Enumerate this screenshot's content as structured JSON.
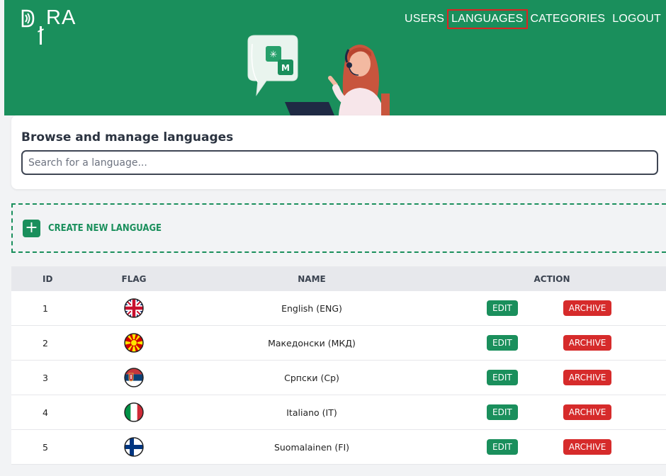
{
  "app": {
    "logo_text": "DIRA"
  },
  "nav": {
    "items": [
      {
        "label": "USERS"
      },
      {
        "label": "LANGUAGES",
        "active": true
      },
      {
        "label": "CATEGORIES"
      },
      {
        "label": "LOGOUT"
      }
    ]
  },
  "search": {
    "title": "Browse and manage languages",
    "placeholder": "Search for a language...",
    "value": ""
  },
  "create": {
    "label": "CREATE NEW LANGUAGE"
  },
  "table": {
    "headers": {
      "id": "ID",
      "flag": "FLAG",
      "name": "NAME",
      "action": "ACTION"
    },
    "rows": [
      {
        "id": "1",
        "flag": "uk-flag-icon",
        "name": "English (ENG)"
      },
      {
        "id": "2",
        "flag": "macedonia-flag-icon",
        "name": "Македонски (МКД)"
      },
      {
        "id": "3",
        "flag": "serbia-flag-icon",
        "name": "Српски (Ср)"
      },
      {
        "id": "4",
        "flag": "italy-flag-icon",
        "name": "Italiano (IT)"
      },
      {
        "id": "5",
        "flag": "finland-flag-icon",
        "name": "Suomalainen (FI)"
      }
    ],
    "edit_label": "EDIT",
    "archive_label": "ARCHIVE"
  },
  "colors": {
    "brand": "#1a8f5c",
    "danger": "#d62b2b",
    "nav_highlight": "#dd2222"
  }
}
